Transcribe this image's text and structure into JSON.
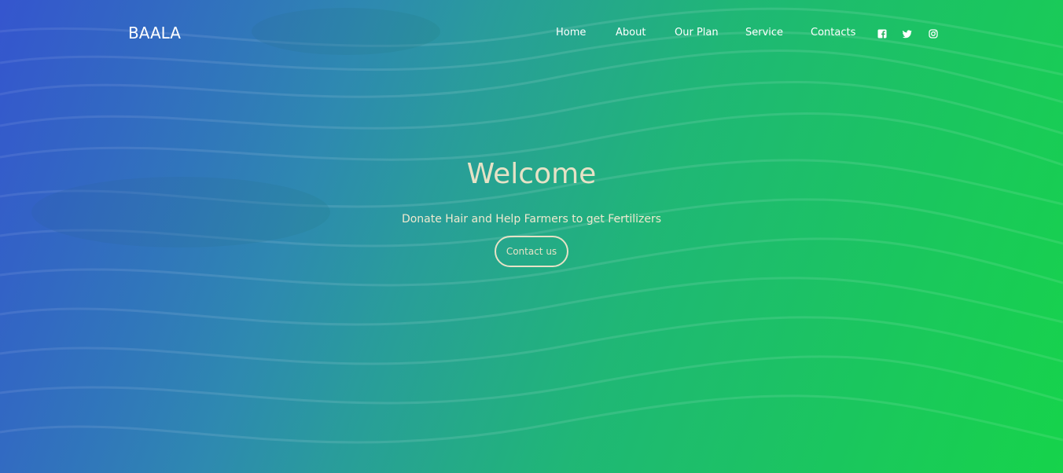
{
  "brand": "BAALA",
  "nav": {
    "items": [
      {
        "label": "Home"
      },
      {
        "label": "About"
      },
      {
        "label": "Our Plan"
      },
      {
        "label": "Service"
      },
      {
        "label": "Contacts"
      }
    ],
    "social": [
      {
        "icon": "facebook-icon"
      },
      {
        "icon": "twitter-icon"
      },
      {
        "icon": "instagram-icon"
      }
    ]
  },
  "hero": {
    "title": "Welcome",
    "subtitle": "Donate Hair and Help Farmers to get Fertilizers",
    "button_label": "Contact us"
  },
  "colors": {
    "gradient_start": "#3657c9",
    "gradient_end": "#18d446",
    "hero_text": "#e6e2c6"
  }
}
